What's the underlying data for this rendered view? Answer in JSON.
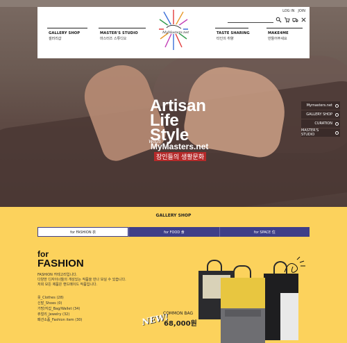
{
  "header": {
    "util_links": [
      "LOG IN",
      "JOIN"
    ],
    "logo_text": "MyMasters.net",
    "nav": [
      {
        "en": "GALLERY SHOP",
        "ko": "갤러리샵"
      },
      {
        "en": "MASTER'S STUDIO",
        "ko": "마스터즈 스튜디오"
      },
      {
        "en": "TASTE SHARING",
        "ko": "타인의 취향"
      },
      {
        "en": "MAKE4ME",
        "ko": "만들어주세요"
      }
    ]
  },
  "hero": {
    "title_line1": "Artisan",
    "title_line2": "Life",
    "title_line3": "Style",
    "with": "with",
    "site": "MyMasters.net",
    "tagline_ko": "장인들의 생활문화",
    "side_links": [
      "Mymasters.net",
      "GALLERY SHOP",
      "CURATION",
      "MASTER'S STUDIO"
    ]
  },
  "gallery": {
    "title": "GALLERY SHOP",
    "tabs": [
      {
        "label": "for FASHION 衣",
        "active": true
      },
      {
        "label": "for FOOD 食",
        "active": false
      },
      {
        "label": "for SPACE 住",
        "active": false
      }
    ],
    "heading_small": "for",
    "heading_big": "FASHION",
    "desc_line1": "FASHION 카테고리입니다.",
    "desc_line2": "다양한 디자이너들의 개성있는 작품을 만나 보실 수 있습니다.",
    "desc_line3": "저희 모든 제품은 핸드메이드 작품입니다.",
    "categories": [
      "옷_Clothes (28)",
      "신발_Shoes (0)",
      "가방/지갑_Bag/Wallet (34)",
      "쥬얼리_Jewelry (32)",
      "패션소품_Fashion item (30)"
    ],
    "new_label": "NEW!",
    "product_name": "COMMON BAG",
    "product_price": "68,000원"
  },
  "colors": {
    "accent_yellow": "#fcd25c",
    "tab_navy": "#3f3f88"
  }
}
